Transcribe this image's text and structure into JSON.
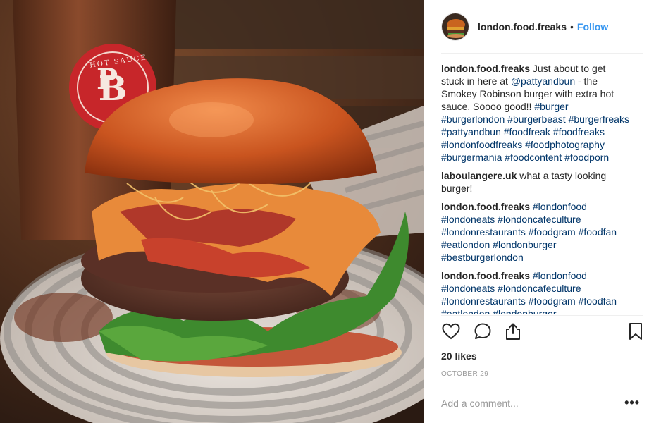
{
  "photo": {
    "stamp_text": "HOT SAUCE",
    "logo_text": "P&B"
  },
  "header": {
    "username": "london.food.freaks",
    "separator": "•",
    "follow_label": "Follow"
  },
  "comments": [
    {
      "user": "london.food.freaks",
      "parts": [
        {
          "type": "text",
          "value": " Just about to get stuck in here at "
        },
        {
          "type": "mention",
          "value": "@pattyandbun"
        },
        {
          "type": "text",
          "value": " - the Smokey Robinson burger with extra hot sauce. Soooo good!! "
        },
        {
          "type": "tag",
          "value": "#burger #burgerlondon #burgerbeast #burgerfreaks #pattyandbun #foodfreak #foodfreaks #londonfoodfreaks #foodphotography #burgermania #foodcontent #foodporn"
        }
      ],
      "likeable": false
    },
    {
      "user": "laboulangere.uk",
      "parts": [
        {
          "type": "text",
          "value": " what a tasty looking burger!"
        }
      ],
      "likeable": true
    },
    {
      "user": "london.food.freaks",
      "parts": [
        {
          "type": "tag",
          "value": " #londonfood #londoneats #londoncafeculture #londonrestaurants #foodgram #foodfan #eatlondon #londonburger #bestburgerlondon"
        }
      ],
      "likeable": true
    },
    {
      "user": "london.food.freaks",
      "parts": [
        {
          "type": "tag",
          "value": " #londonfood #londoneats #londoncafeculture #londonrestaurants #foodgram #foodfan #eatlondon #londonburger"
        }
      ],
      "likeable": true
    }
  ],
  "actions": {
    "like_icon": "heart-icon",
    "comment_icon": "comment-bubble-icon",
    "share_icon": "share-icon",
    "save_icon": "bookmark-icon"
  },
  "likes_label": "20 likes",
  "date_label": "OCTOBER 29",
  "add_comment": {
    "placeholder": "Add a comment...",
    "more_label": "•••"
  },
  "colors": {
    "link": "#003569",
    "follow": "#3897f0",
    "muted": "#999999",
    "text": "#262626"
  }
}
